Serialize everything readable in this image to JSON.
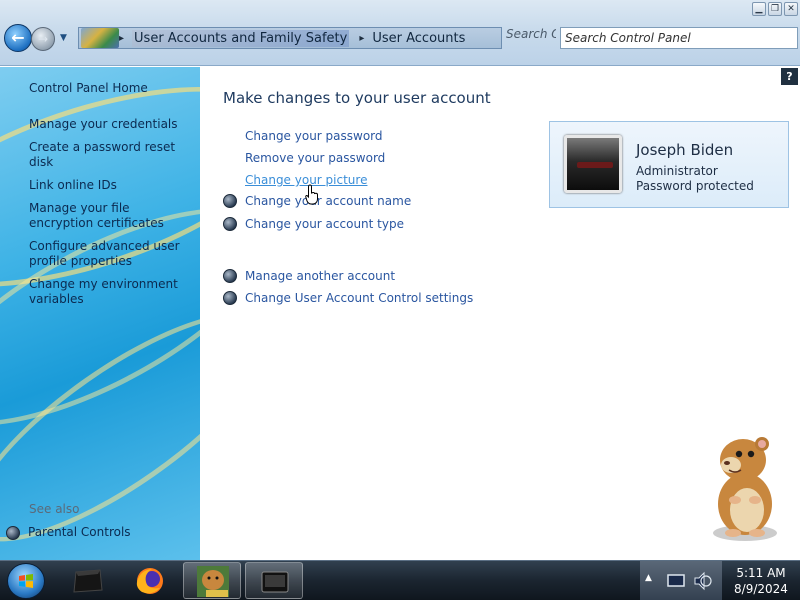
{
  "window": {
    "controls": {
      "minimize": "▁",
      "restore": "❐",
      "close": "✕"
    }
  },
  "nav": {
    "back_icon": "back-arrow-icon",
    "forward_icon": "forward-arrow-icon",
    "back_glyph": "←",
    "forward_glyph": "→",
    "dropdown_glyph": "▼"
  },
  "address": {
    "separator": "▸",
    "crumbs": [
      "User Accounts and Family Safety",
      "User Accounts"
    ]
  },
  "search": {
    "ghost": "Search C",
    "placeholder": "Search Control Panel"
  },
  "left": {
    "links": [
      "Control Panel Home",
      "Manage your credentials",
      "Create a password reset disk",
      "Link online IDs",
      "Manage your file encryption certificates",
      "Configure advanced user profile properties",
      "Change my environment variables"
    ],
    "see_also": "See also",
    "parental_controls": "Parental Controls"
  },
  "main": {
    "help": "?",
    "title": "Make changes to your user account",
    "tasks": [
      "Change your password",
      "Remove your password",
      "Change your picture"
    ],
    "shield_tasks": [
      "Change your account name",
      "Change your account type"
    ],
    "other_tasks": [
      "Manage another account",
      "Change User Account Control settings"
    ]
  },
  "user": {
    "name": "Joseph Biden",
    "role": "Administrator",
    "status": "Password protected"
  },
  "taskbar": {
    "time": "5:11 AM",
    "date": "8/9/2024"
  },
  "colors": {
    "link": "#2a56a0",
    "link_hover": "#3a8ed8",
    "accent": "#1a9bd8"
  }
}
